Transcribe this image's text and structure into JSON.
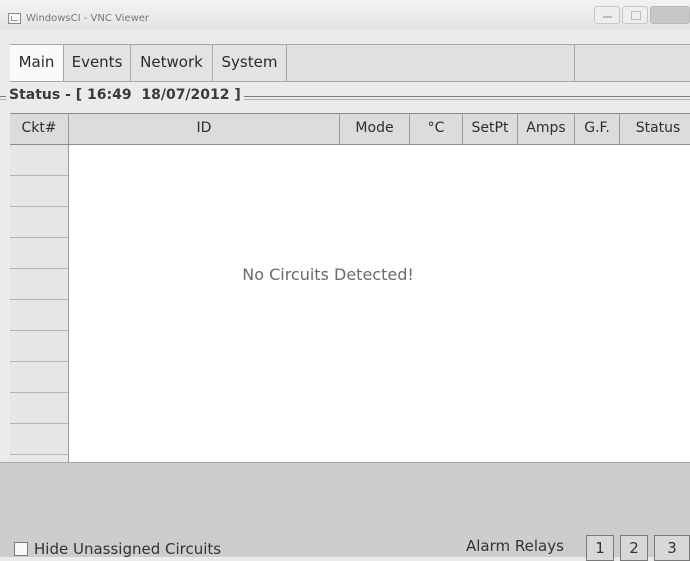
{
  "window": {
    "title": "WindowsCI - VNC Viewer"
  },
  "tabs": [
    {
      "label": "Main",
      "active": true
    },
    {
      "label": "Events",
      "active": false
    },
    {
      "label": "Network",
      "active": false
    },
    {
      "label": "System",
      "active": false
    }
  ],
  "status": {
    "label": "Status - [ 16:49  18/07/2012 ]"
  },
  "table": {
    "columns": [
      "Ckt#",
      "ID",
      "Mode",
      "°C",
      "SetPt",
      "Amps",
      "G.F.",
      "Status"
    ],
    "rows": [],
    "empty_message": "No Circuits Detected!"
  },
  "footer": {
    "hide_unassigned_label": "Hide Unassigned Circuits",
    "hide_unassigned_checked": false,
    "alarm_relays_label": "Alarm Relays",
    "relays": [
      "1",
      "2",
      "3"
    ]
  }
}
